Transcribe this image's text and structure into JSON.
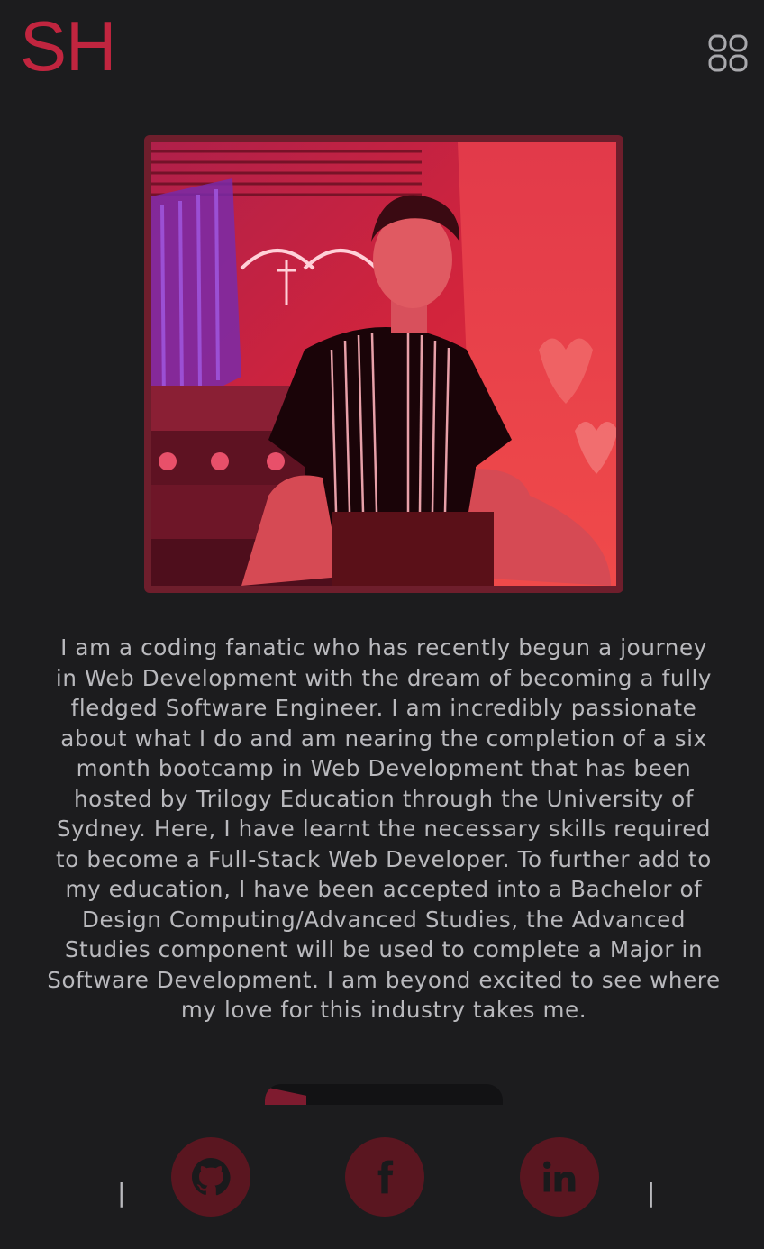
{
  "header": {
    "logo_text": "SH",
    "menu_icon": "grid-four-squares-icon"
  },
  "profile": {
    "photo_alt": "Profile photo"
  },
  "about": {
    "bio": "I am a coding fanatic who has recently begun a journey in Web Development with the dream of becoming a fully fledged Software Engineer. I am incredibly passionate about what I do and am nearing the completion of a six month bootcamp in Web Development that has been hosted by Trilogy Education through the University of Sydney. Here, I have learnt the necessary skills required to become a Full-Stack Web Developer. To further add to my education, I have been accepted into a Bachelor of Design Computing/Advanced Studies, the Advanced Studies component will be used to complete a Major in Software Development. I am beyond excited to see where my love for this industry takes me."
  },
  "footer": {
    "separator": "|",
    "socials": [
      {
        "name": "github",
        "icon": "github-icon"
      },
      {
        "name": "facebook",
        "icon": "facebook-icon"
      },
      {
        "name": "linkedin",
        "icon": "linkedin-icon"
      }
    ]
  },
  "colors": {
    "background": "#1c1c1e",
    "accent": "#c1253f",
    "text": "#b9b9bd",
    "frame": "#6e1e2c",
    "social_bg": "#5a1620"
  }
}
